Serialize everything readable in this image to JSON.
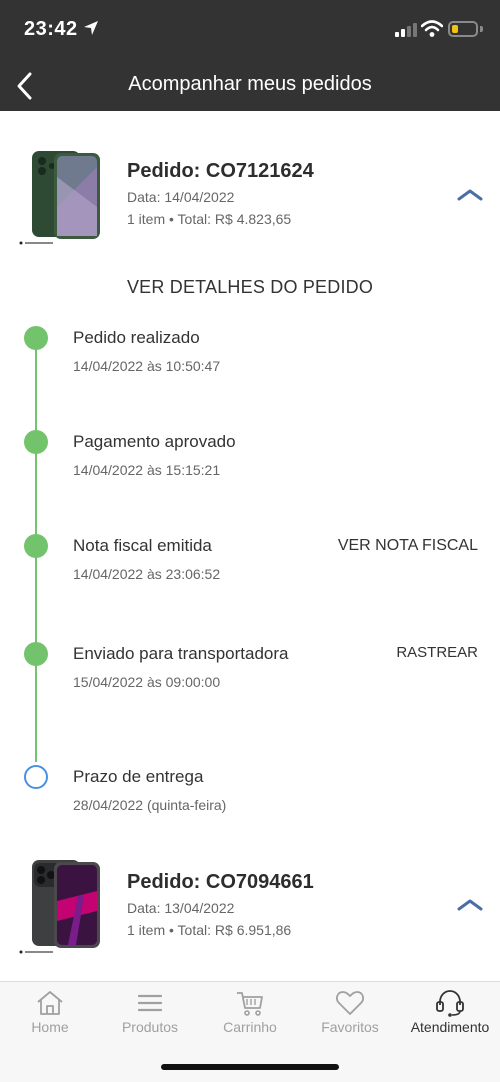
{
  "status": {
    "time": "23:42"
  },
  "header": {
    "title": "Acompanhar meus pedidos"
  },
  "orders": [
    {
      "title": "Pedido: CO7121624",
      "date": "Data: 14/04/2022",
      "summary": "1 item • Total: R$ 4.823,65"
    },
    {
      "title": "Pedido: CO7094661",
      "date": "Data: 13/04/2022",
      "summary": "1 item • Total: R$ 6.951,86"
    }
  ],
  "details_label": "VER DETALHES DO PEDIDO",
  "timeline": [
    {
      "title": "Pedido realizado",
      "date": "14/04/2022 às 10:50:47",
      "action": ""
    },
    {
      "title": "Pagamento aprovado",
      "date": "14/04/2022 às 15:15:21",
      "action": ""
    },
    {
      "title": "Nota fiscal emitida",
      "date": "14/04/2022 às 23:06:52",
      "action": "VER NOTA FISCAL"
    },
    {
      "title": "Enviado para transportadora",
      "date": "15/04/2022 às 09:00:00",
      "action": "RASTREAR"
    },
    {
      "title": "Prazo de entrega",
      "date": "28/04/2022 (quinta-feira)",
      "action": ""
    }
  ],
  "nav": [
    {
      "label": "Home",
      "icon": "home-icon"
    },
    {
      "label": "Produtos",
      "icon": "menu-icon"
    },
    {
      "label": "Carrinho",
      "icon": "cart-icon"
    },
    {
      "label": "Favoritos",
      "icon": "heart-icon"
    },
    {
      "label": "Atendimento",
      "icon": "headset-icon"
    }
  ],
  "colors": {
    "bar": "#333333",
    "done": "#72c36b",
    "pending": "#4a90e2",
    "accent": "#4a6fa5"
  }
}
